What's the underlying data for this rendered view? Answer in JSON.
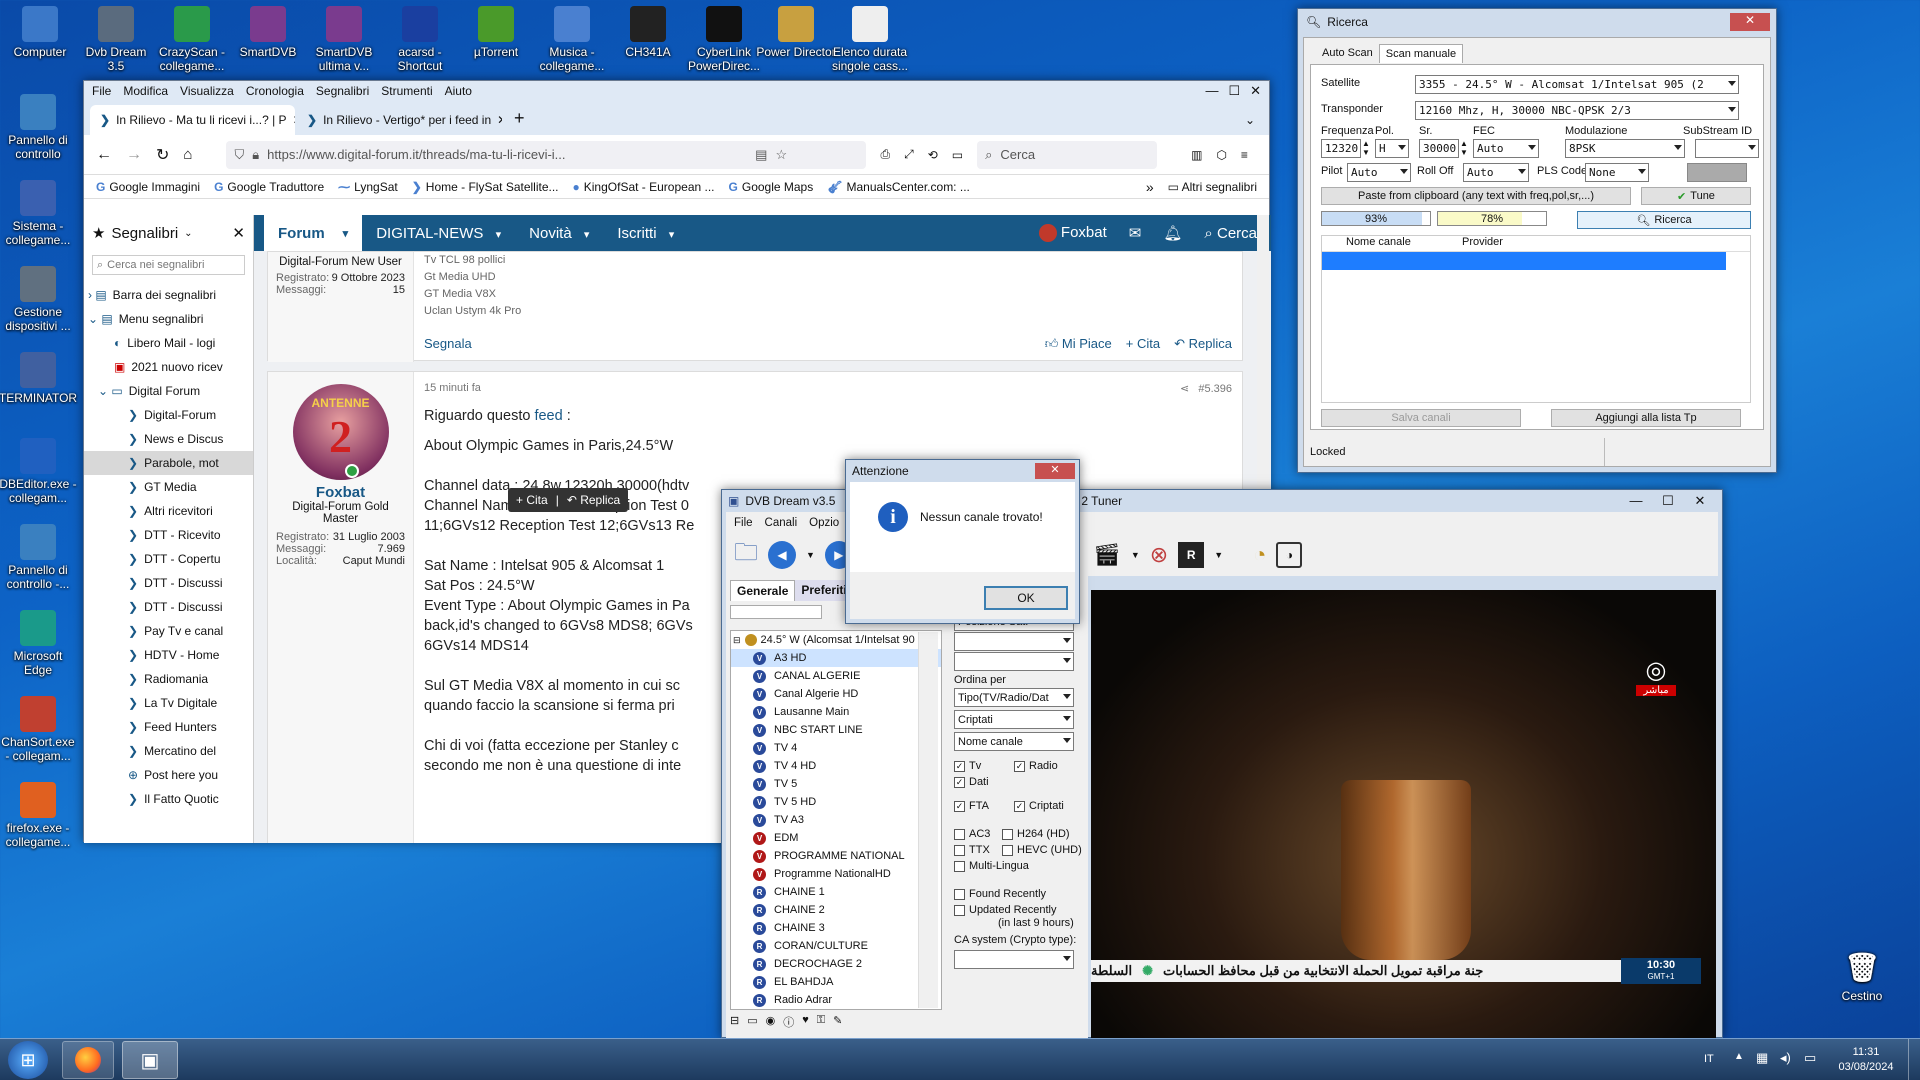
{
  "desktop": {
    "icons": [
      {
        "label": "Computer",
        "color": "#3b78c8"
      },
      {
        "label": "Dvb Dream 3.5",
        "color": "#5a6b7e"
      },
      {
        "label": "CrazyScan - collegame...",
        "color": "#2a9a4a"
      },
      {
        "label": "SmartDVB",
        "color": "#7a3b8e"
      },
      {
        "label": "SmartDVB ultima v...",
        "color": "#7a3b8e"
      },
      {
        "label": "acarsd - Shortcut",
        "color": "#1a3fa0"
      },
      {
        "label": "µTorrent",
        "color": "#4a9a2a"
      },
      {
        "label": "Musica - collegame...",
        "color": "#4a80d0"
      },
      {
        "label": "CH341A",
        "color": "#222"
      },
      {
        "label": "CyberLink PowerDirec...",
        "color": "#111"
      },
      {
        "label": "Power Director",
        "color": "#c8a040"
      },
      {
        "label": "Elenco durata singole cass...",
        "color": "#eeeeee"
      }
    ],
    "left_icons": [
      {
        "label": "Pannello di controllo",
        "color": "#3a80c0"
      },
      {
        "label": "Sistema - collegame...",
        "color": "#3a60b0"
      },
      {
        "label": "Gestione dispositivi ...",
        "color": "#607080"
      },
      {
        "label": "TERMINATOR",
        "color": "#4060a0"
      },
      {
        "label": "DBEditor.exe - collegam...",
        "color": "#2060c0"
      },
      {
        "label": "Pannello di controllo -...",
        "color": "#3a80c0"
      },
      {
        "label": "Microsoft Edge",
        "color": "#1a9a8a"
      },
      {
        "label": "ChanSort.exe - collegam...",
        "color": "#c04030"
      },
      {
        "label": "firefox.exe - collegame...",
        "color": "#e06020"
      }
    ],
    "recycle": "Cestino"
  },
  "browser": {
    "menu": [
      "File",
      "Modifica",
      "Visualizza",
      "Cronologia",
      "Segnalibri",
      "Strumenti",
      "Aiuto"
    ],
    "tabs": [
      {
        "label": "In Rilievo - Ma tu li ricevi i...? | P"
      },
      {
        "label": "In Rilievo - Vertigo* per i feed in"
      }
    ],
    "url": "https://www.digital-forum.it/threads/ma-tu-li-ricevi-i...",
    "search_placeholder": "Cerca",
    "bookmarks": [
      "Google Immagini",
      "Google Traduttore",
      "LyngSat",
      "Home - FlySat Satellite...",
      "KingOfSat - European ...",
      "Google Maps",
      "ManualsCenter.com: ..."
    ],
    "bookmarks_other": "Altri segnalibri",
    "sidebar": {
      "title": "Segnalibri",
      "search": "Cerca nei segnalibri",
      "items": [
        "Barra dei segnalibri",
        "Menu segnalibri",
        "Libero Mail - logi",
        "2021 nuovo ricev",
        "Digital Forum",
        "Digital-Forum",
        "News e Discus",
        "Parabole, mot",
        "GT Media",
        "Altri ricevitori",
        "DTT - Ricevito",
        "DTT - Copertu",
        "DTT - Discussi",
        "DTT - Discussi",
        "Pay Tv e canal",
        "HDTV - Home",
        "Radiomania",
        "La Tv Digitale",
        "Feed Hunters",
        "Mercatino del",
        "Post here you",
        "Il Fatto Quotic"
      ]
    },
    "forum": {
      "nav": [
        "Forum",
        "DIGITAL-NEWS",
        "Novità",
        "Iscritti"
      ],
      "user": "Foxbat",
      "search": "Cerca"
    },
    "post1": {
      "rank": "Digital-Forum New User",
      "reg_label": "Registrato:",
      "reg": "9 Ottobre 2023",
      "msg_label": "Messaggi:",
      "msg": "15",
      "lines": [
        "Tv TCL 98 pollici",
        "Gt Media UHD",
        "GT Media V8X",
        "Uclan Ustym 4k Pro"
      ],
      "report": "Segnala",
      "like": "Mi Piace",
      "quote": "Cita",
      "reply": "Replica"
    },
    "post2": {
      "time": "15 minuti fa",
      "num": "#5.396",
      "avatar_text": "ANTENNE",
      "avatar_num": "2",
      "user": "Foxbat",
      "rank": "Digital-Forum Gold Master",
      "reg_label": "Registrato:",
      "reg": "31 Luglio 2003",
      "msg_label": "Messaggi:",
      "msg": "7.969",
      "loc_label": "Località:",
      "loc": "Caput Mundi",
      "line1a": "Riguardo questo ",
      "line1b": "feed",
      " line1c": " :",
      "lines": [
        "About Olympic Games in Paris,24.5°W",
        "",
        "Channel data : 24.8w,12320h,30000(hdtv",
        "Channel Name : 6GVs8 Reception Test 0",
        "11;6GVs12 Reception Test 12;6GVs13 Re",
        "",
        "Sat Name : Intelsat 905 & Alcomsat 1",
        "Sat Pos : 24.5°W",
        "Event Type : About Olympic Games in Pa",
        "back,id's changed to 6GVs8 MDS8; 6GVs",
        "6GVs14 MDS14",
        "",
        "Sul GT Media V8X al momento in cui sc",
        "quando faccio la scansione si ferma pri",
        "",
        "Chi di voi (fatta eccezione per Stanley c",
        "secondo me non è una questione di inte"
      ],
      "popup_quote": "+ Cita",
      "popup_reply": "Replica"
    }
  },
  "ricerca": {
    "title": "Ricerca",
    "tabs": [
      "Auto Scan",
      "Scan manuale"
    ],
    "satellite_label": "Satellite",
    "satellite": "3355 - 24.5° W - Alcomsat 1/Intelsat 905 (2",
    "transponder_label": "Transponder",
    "transponder": "12160 Mhz, H, 30000  NBC-QPSK 2/3",
    "freq_label": "Frequenza",
    "freq": "12320",
    "pol_label": "Pol.",
    "pol": "H",
    "sr_label": "Sr.",
    "sr": "30000",
    "fec_label": "FEC",
    "fec": "Auto",
    "mod_label": "Modulazione",
    "mod": "8PSK",
    "substream_label": "SubStream ID",
    "pilot_label": "Pilot",
    "pilot": "Auto",
    "rolloff_label": "Roll Off",
    "rolloff": "Auto",
    "pls_label": "PLS Code",
    "pls": "None",
    "paste": "Paste from clipboard  (any text with freq,pol,sr,...)",
    "tune": "Tune",
    "bar1": "93%",
    "bar2": "78%",
    "search_btn": "Ricerca",
    "col1": "Nome canale",
    "col2": "Provider",
    "save": "Salva canali",
    "add": "Aggiungi alla lista Tp",
    "status": "Locked"
  },
  "dvb": {
    "title": "DVB Dream v3.5",
    "title2": "2 Tuner",
    "menu": [
      "File",
      "Canali",
      "Opzio"
    ],
    "tabs": [
      "Generale",
      "Preferiti"
    ],
    "sat": "24.5° W (Alcomsat 1/Intelsat 90",
    "channels": [
      {
        "name": "A3 HD",
        "t": "V",
        "c": "#2a4a9a"
      },
      {
        "name": "CANAL ALGERIE",
        "t": "V",
        "c": "#2a4a9a"
      },
      {
        "name": "Canal Algerie HD",
        "t": "V",
        "c": "#2a4a9a"
      },
      {
        "name": "Lausanne Main",
        "t": "V",
        "c": "#2a4a9a"
      },
      {
        "name": "NBC START LINE",
        "t": "V",
        "c": "#2a4a9a"
      },
      {
        "name": "TV 4",
        "t": "V",
        "c": "#2a4a9a"
      },
      {
        "name": "TV 4 HD",
        "t": "V",
        "c": "#2a4a9a"
      },
      {
        "name": "TV 5",
        "t": "V",
        "c": "#2a4a9a"
      },
      {
        "name": "TV 5 HD",
        "t": "V",
        "c": "#2a4a9a"
      },
      {
        "name": "TV A3",
        "t": "V",
        "c": "#2a4a9a"
      },
      {
        "name": "EDM",
        "t": "V",
        "c": "#b01818"
      },
      {
        "name": "PROGRAMME NATIONAL",
        "t": "V",
        "c": "#b01818"
      },
      {
        "name": "Programme NationalHD",
        "t": "V",
        "c": "#b01818"
      },
      {
        "name": "CHAINE 1",
        "t": "R",
        "c": "#2a4a9a"
      },
      {
        "name": "CHAINE 2",
        "t": "R",
        "c": "#2a4a9a"
      },
      {
        "name": "CHAINE 3",
        "t": "R",
        "c": "#2a4a9a"
      },
      {
        "name": "CORAN/CULTURE",
        "t": "R",
        "c": "#2a4a9a"
      },
      {
        "name": "DECROCHAGE 2",
        "t": "R",
        "c": "#2a4a9a"
      },
      {
        "name": "EL BAHDJA",
        "t": "R",
        "c": "#2a4a9a"
      },
      {
        "name": "Radio Adrar",
        "t": "R",
        "c": "#2a4a9a"
      }
    ],
    "filters": {
      "pos": "Posizione Sat.",
      "order_label": "Ordina per",
      "order": "Tipo(TV/Radio/Dat",
      "cript": "Criptati",
      "name": "Nome canale",
      "tv": "Tv",
      "radio": "Radio",
      "dati": "Dati",
      "fta": "FTA",
      "criptati": "Criptati",
      "ac3": "AC3",
      "h264": "H264 (HD)",
      "ttx": "TTX",
      "hevc": "HEVC (UHD)",
      "multi": "Multi-Lingua",
      "found": "Found Recently",
      "updated": "Updated Recently",
      "updated2": "(in last 9 hours)",
      "ca": "CA system (Crypto type):"
    },
    "ticker": "جنة مراقبة تمويل الحملة الانتخابية من قبل محافظ الحسابات",
    "ticker2": "السلطة",
    "clock": "10:30",
    "gmt": "GMT+1",
    "logo_live": "مباشر"
  },
  "dialog": {
    "title": "Attenzione",
    "message": "Nessun canale trovato!",
    "ok": "OK"
  },
  "taskbar": {
    "lang": "IT",
    "time": "11:31",
    "date": "03/08/2024"
  }
}
